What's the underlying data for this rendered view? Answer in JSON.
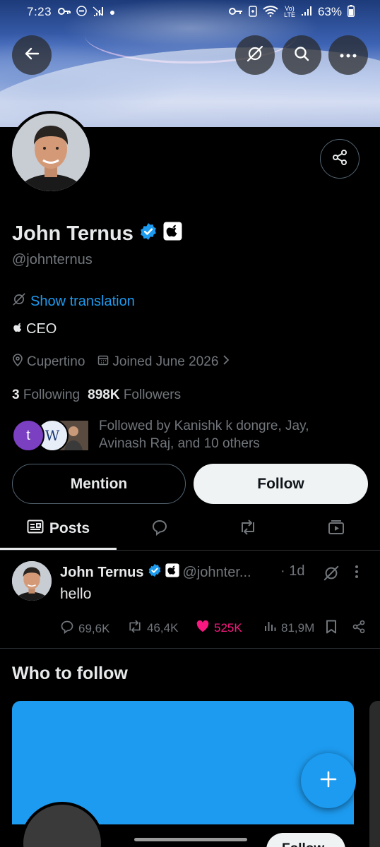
{
  "status_bar": {
    "time": "7:23",
    "battery_percent": "63%"
  },
  "profile": {
    "name": "John Ternus",
    "handle": "@johnternus",
    "show_translation": "Show translation",
    "bio": "CEO",
    "location": "Cupertino",
    "joined": "Joined June 2026",
    "following_count": "3",
    "following_label": "Following",
    "followers_count": "898K",
    "followers_label": "Followers",
    "followed_by_text": "Followed by Kanishk k dongre, Jay, Avinash Raj, and 10 others",
    "follower_avatar_1_letter": "t",
    "follower_avatar_2_letter": "W"
  },
  "actions": {
    "mention_label": "Mention",
    "follow_label": "Follow"
  },
  "tabs": {
    "posts_label": "Posts"
  },
  "post": {
    "author_name": "John Ternus",
    "author_handle": "@johnter...",
    "time": "· 1d",
    "text": "hello",
    "replies": "69,6K",
    "reposts": "46,4K",
    "likes": "525K",
    "views": "81,9M"
  },
  "who_to_follow": {
    "title": "Who to follow",
    "card_follow_label": "Follow"
  },
  "colors": {
    "accent": "#1d9bf0",
    "like": "#f91880",
    "muted": "#71767b",
    "background": "#000000"
  }
}
